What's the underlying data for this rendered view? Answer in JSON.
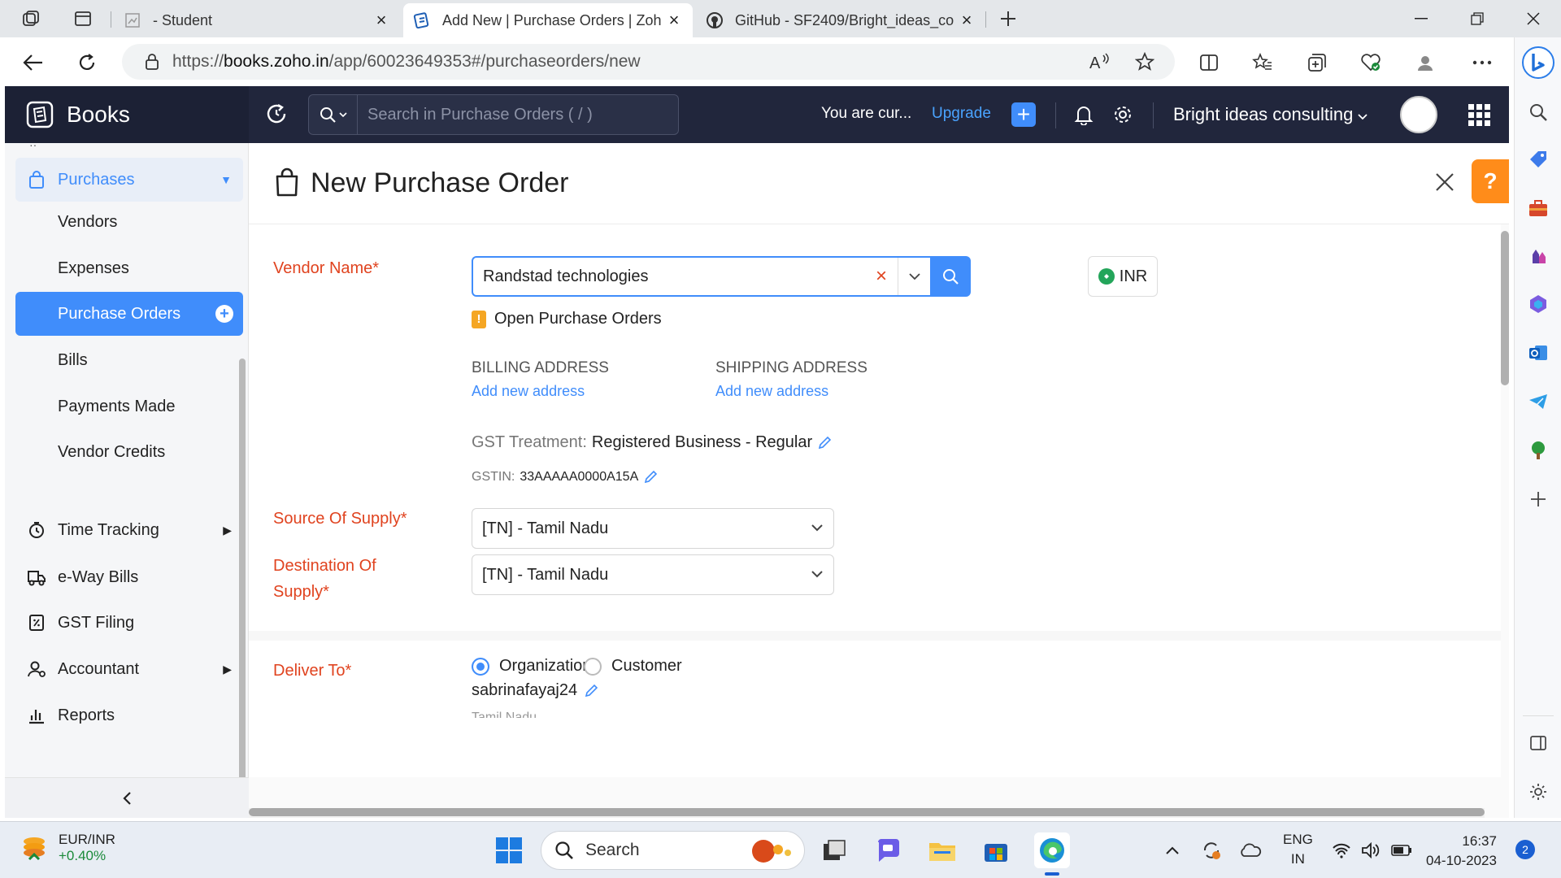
{
  "browser": {
    "tabs": [
      {
        "label": "- Student",
        "active": false
      },
      {
        "label": "Add New | Purchase Orders | Zoh",
        "active": true
      },
      {
        "label": "GitHub - SF2409/Bright_ideas_co",
        "active": false
      }
    ],
    "url_prefix": "https://",
    "url_host": "books.zoho.in",
    "url_path": "/app/60023649353#/purchaseorders/new"
  },
  "app": {
    "brand": "Books",
    "search_placeholder": "Search in Purchase Orders ( / )",
    "trial_text": "You are cur...",
    "upgrade_label": "Upgrade",
    "org_name": "Bright ideas consulting",
    "accent": "#408dfb"
  },
  "sidebar": {
    "section": "Purchases",
    "sub_items": [
      {
        "label": "Vendors"
      },
      {
        "label": "Expenses"
      },
      {
        "label": "Purchase Orders",
        "active": true
      },
      {
        "label": "Bills"
      },
      {
        "label": "Payments Made"
      },
      {
        "label": "Vendor Credits"
      }
    ],
    "main_items": [
      {
        "label": "Time Tracking",
        "icon": "stopwatch-icon",
        "arrow": true
      },
      {
        "label": "e-Way Bills",
        "icon": "truck-icon",
        "arrow": false
      },
      {
        "label": "GST Filing",
        "icon": "gst-document-icon",
        "arrow": false
      },
      {
        "label": "Accountant",
        "icon": "accountant-icon",
        "arrow": true
      },
      {
        "label": "Reports",
        "icon": "bar-chart-icon",
        "arrow": false
      }
    ]
  },
  "form": {
    "title": "New Purchase Order",
    "vendor_label": "Vendor Name*",
    "vendor_value": "Randstad technologies",
    "currency": "INR",
    "open_po_link": "Open Purchase Orders",
    "billing_address_label": "BILLING ADDRESS",
    "shipping_address_label": "SHIPPING ADDRESS",
    "add_new_address": "Add new address",
    "gst_treatment_label": "GST Treatment:",
    "gst_treatment_value": "Registered Business - Regular",
    "gstin_label": "GSTIN:",
    "gstin_value": "33AAAAA0000A15A",
    "source_label": "Source Of Supply*",
    "source_value": "[TN] - Tamil Nadu",
    "destination_label_1": "Destination Of",
    "destination_label_2": "Supply*",
    "destination_value": "[TN] - Tamil Nadu",
    "deliver_label": "Deliver To*",
    "deliver_options": [
      "Organization",
      "Customer"
    ],
    "deliver_selected": "Organization",
    "deliver_user": "sabrinafayaj24",
    "cutoff_text": "Tamil Nadu"
  },
  "taskbar": {
    "ticker_name": "EUR/INR",
    "ticker_change": "+0.40%",
    "search_label": "Search",
    "lang_1": "ENG",
    "lang_2": "IN",
    "time": "16:37",
    "date": "04-10-2023",
    "notifications": "2"
  }
}
